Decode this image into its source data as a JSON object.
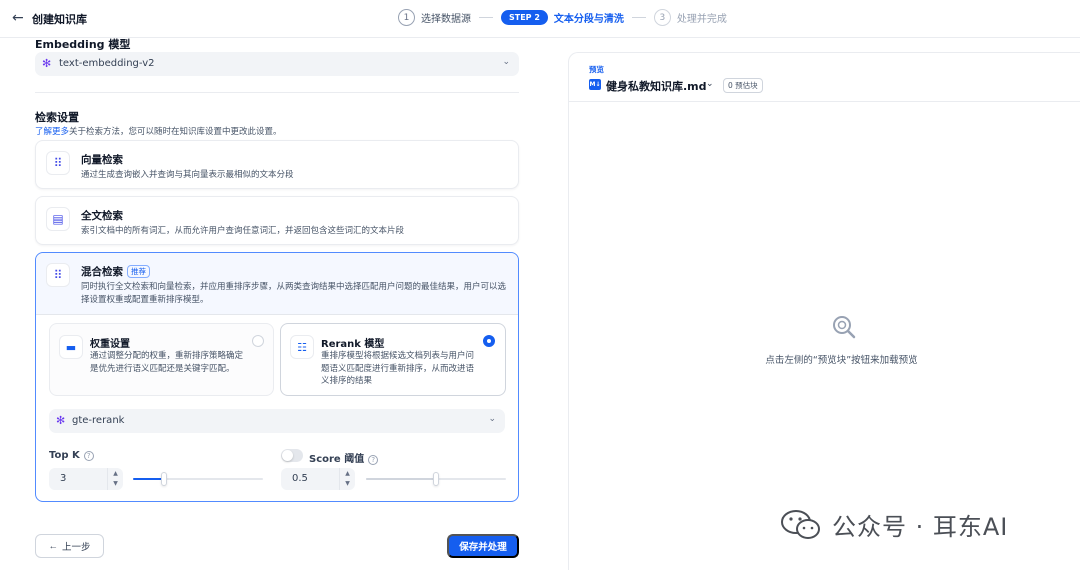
{
  "header": {
    "title": "创建知识库",
    "steps": [
      {
        "num": "1",
        "label": "选择数据源"
      },
      {
        "badge": "STEP 2",
        "label": "文本分段与清洗"
      },
      {
        "num": "3",
        "label": "处理并完成"
      }
    ]
  },
  "embedding": {
    "title": "Embedding 模型",
    "model": "text-embedding-v2"
  },
  "retrieval": {
    "title": "检索设置",
    "hint_link": "了解更多",
    "hint_text": "关于检索方法，您可以随时在知识库设置中更改此设置。",
    "vector": {
      "title": "向量检索",
      "desc": "通过生成查询嵌入并查询与其向量表示最相似的文本分段"
    },
    "fulltext": {
      "title": "全文检索",
      "desc": "索引文档中的所有词汇，从而允许用户查询任意词汇，并返回包含这些词汇的文本片段"
    },
    "hybrid": {
      "title": "混合检索",
      "badge": "推荐",
      "desc": "同时执行全文检索和向量检索，并应用重排序步骤，从两类查询结果中选择匹配用户问题的最佳结果，用户可以选择设置权重或配置重新排序模型。",
      "weight": {
        "title": "权重设置",
        "desc_line1": "通过调整分配的权重，重新排序策略确定",
        "desc_line2": "是优先进行语义匹配还是关键字匹配。",
        "selected": false
      },
      "rerank": {
        "title": "Rerank 模型",
        "desc_line1": "重排序模型将根据候选文档列表与用户问",
        "desc_line2": "题语义匹配度进行重新排序，从而改进语",
        "desc_line3": "义排序的结果",
        "selected": true
      },
      "rerank_model": "gte-rerank",
      "topk": {
        "label": "Top K",
        "value": "3",
        "slider_fraction": 0.24
      },
      "score": {
        "label": "Score 阈值",
        "value": "0.5",
        "enabled": false,
        "slider_fraction": 0.5
      }
    }
  },
  "actions": {
    "prev": "上一步",
    "save": "保存并处理"
  },
  "preview": {
    "label": "预览",
    "doc_name": "健身私教知识库.md",
    "chunk_badge": "0 预估块",
    "empty_text": "点击左侧的“预览块”按钮来加载预览"
  },
  "watermark": "公众号 · 耳东AI",
  "colors": {
    "accent": "#155eef",
    "icon_purple": "#6938ef"
  }
}
